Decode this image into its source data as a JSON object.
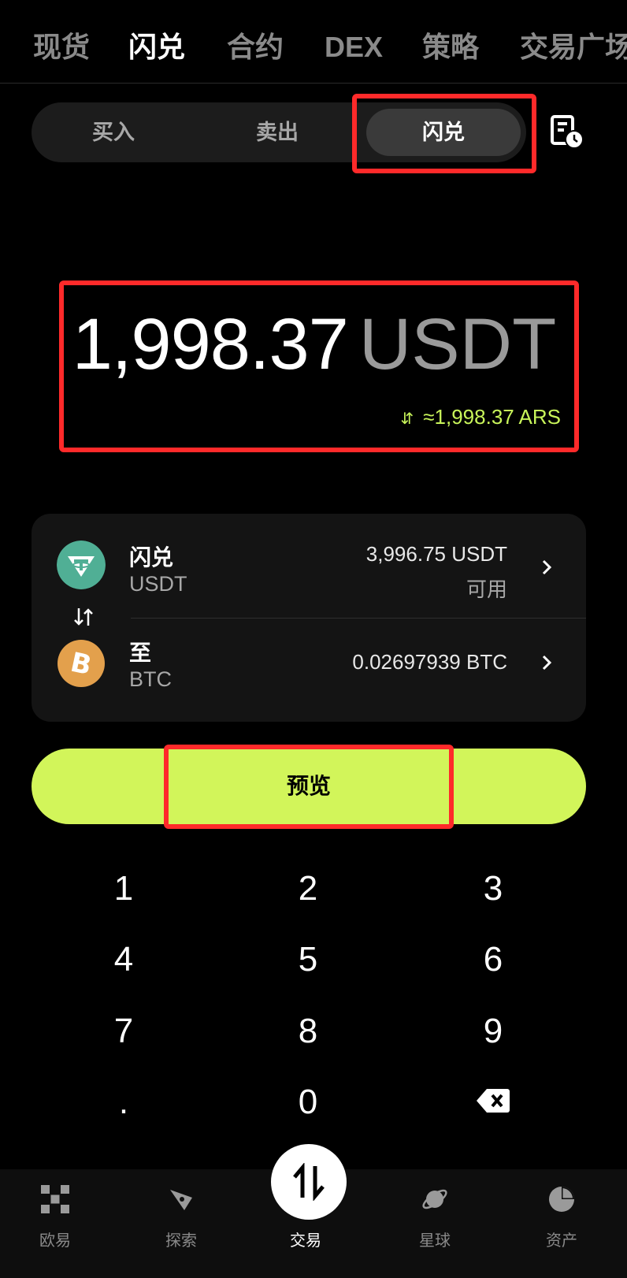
{
  "top_tabs": [
    "现货",
    "闪兑",
    "合约",
    "DEX",
    "策略",
    "交易广场"
  ],
  "segment": {
    "buy": "买入",
    "sell": "卖出",
    "convert": "闪兑"
  },
  "amount": {
    "value": "1,998.37",
    "unit": "USDT",
    "fiat": "≈1,998.37 ARS",
    "swap_glyph": "⇵"
  },
  "from": {
    "label": "闪兑",
    "symbol": "USDT",
    "balance": "3,996.75 USDT",
    "available": "可用"
  },
  "to": {
    "label": "至",
    "symbol": "BTC",
    "amount": "0.02697939 BTC"
  },
  "preview_label": "预览",
  "keypad": [
    "1",
    "2",
    "3",
    "4",
    "5",
    "6",
    "7",
    "8",
    "9",
    ".",
    "0"
  ],
  "bottom_nav": {
    "home": "欧易",
    "explore": "探索",
    "trade": "交易",
    "planet": "星球",
    "assets": "资产"
  },
  "colors": {
    "accent": "#d2f55a",
    "highlight": "#ff2a2a",
    "usdt": "#50af95",
    "btc": "#e3a04c"
  }
}
